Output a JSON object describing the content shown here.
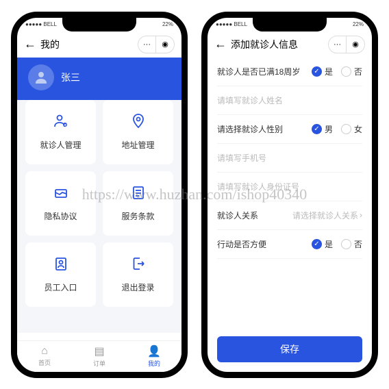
{
  "status": {
    "carrier": "●●●●● BELL",
    "battery": "22%"
  },
  "left": {
    "title": "我的",
    "username": "张三",
    "cards": [
      {
        "label": "就诊人管理"
      },
      {
        "label": "地址管理"
      },
      {
        "label": "隐私协议"
      },
      {
        "label": "服务条款"
      },
      {
        "label": "员工入口"
      },
      {
        "label": "退出登录"
      }
    ],
    "tabs": [
      {
        "label": "首页"
      },
      {
        "label": "订单"
      },
      {
        "label": "我的"
      }
    ]
  },
  "right": {
    "title": "添加就诊人信息",
    "rows": {
      "age": {
        "label": "就诊人是否已满18周岁",
        "opt1": "是",
        "opt2": "否"
      },
      "name_ph": "请填写就诊人姓名",
      "gender": {
        "label": "请选择就诊人性别",
        "opt1": "男",
        "opt2": "女"
      },
      "phone_ph": "请填写手机号",
      "idcard_ph": "请填写就诊人身份证号",
      "relation": {
        "label": "就诊人关系",
        "ph": "请选择就诊人关系"
      },
      "mobility": {
        "label": "行动是否方便",
        "opt1": "是",
        "opt2": "否"
      }
    },
    "save": "保存"
  },
  "watermark": "https://www.huzhan.com/ishop40340"
}
